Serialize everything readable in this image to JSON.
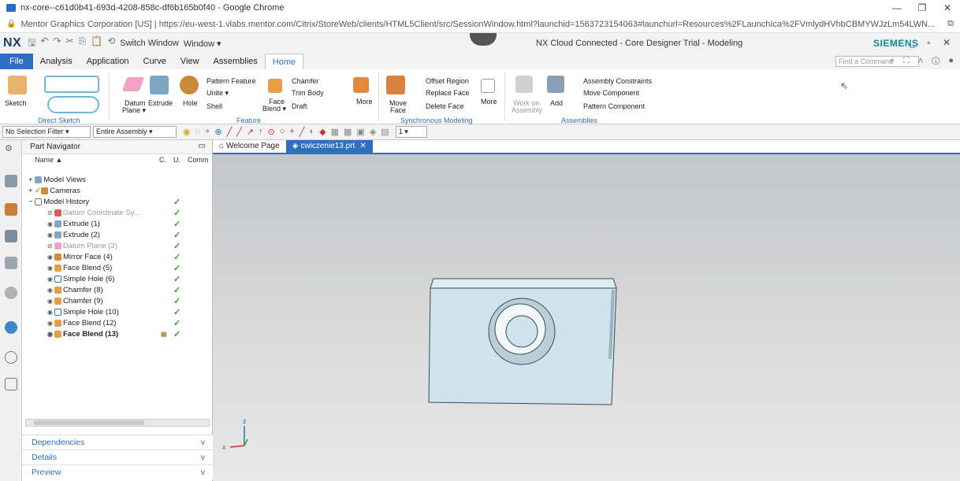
{
  "browser": {
    "title": "nx-core--c61d0b41-693d-4208-858c-df6b165b0f40 - Google Chrome",
    "url": "Mentor Graphics Corporation [US]  |  https://eu-west-1.vlabs.mentor.com/Citrix/StoreWeb/clients/HTML5Client/src/SessionWindow.html?launchid=1563723154063#launchurl=Resources%2FLaunchIca%2FVmlydHVhbCBMYWJzLm54LWN..."
  },
  "app": {
    "logo": "NX",
    "switch_window": "Switch Window",
    "window_menu": "Window ▾",
    "title": "NX Cloud Connected - Core Designer Trial - Modeling",
    "brand": "SIEMENS",
    "find_command": "Find a Command"
  },
  "tabs": [
    "File",
    "Analysis",
    "Application",
    "Curve",
    "View",
    "Assemblies",
    "Home"
  ],
  "ribbon": {
    "sketch": "Sketch",
    "direct_sketch": "Direct Sketch",
    "datum_plane": "Datum",
    "datum_plane2": "Plane ▾",
    "extrude": "Extrude",
    "hole": "Hole",
    "pattern_feature": "Pattern Feature",
    "unite": "Unite ▾",
    "shell": "Shell",
    "chamfer": "Chamfer",
    "trim_body": "Trim Body",
    "draft": "Draft",
    "face_blend": "Face",
    "face_blend2": "Blend ▾",
    "more": "More",
    "feature": "Feature",
    "move_face": "Move",
    "move_face2": "Face",
    "offset_region": "Offset Region",
    "replace_face": "Replace Face",
    "delete_face": "Delete Face",
    "more2": "More",
    "synchronous": "Synchronous Modeling",
    "work_on": "Work on",
    "work_on2": "Assembly",
    "add": "Add",
    "assembly_constraints": "Assembly Constraints",
    "move_component": "Move Component",
    "pattern_component": "Pattern Component",
    "assemblies": "Assemblies"
  },
  "selbar": {
    "filter": "No Selection Filter",
    "scope": "Entire Assembly",
    "number": "1"
  },
  "navigator": {
    "title": "Part Navigator",
    "col_name": "Name",
    "col_c": "C.",
    "col_u": "U.",
    "col_comm": "Comm",
    "rows": [
      {
        "label": "Model Views",
        "indent": 0
      },
      {
        "label": "Cameras",
        "indent": 0
      },
      {
        "label": "Model History",
        "indent": 0
      },
      {
        "label": "Datum Coordinate Sy...",
        "indent": 1
      },
      {
        "label": "Extrude (1)",
        "indent": 1
      },
      {
        "label": "Extrude (2)",
        "indent": 1
      },
      {
        "label": "Datum Plane (3)",
        "indent": 1
      },
      {
        "label": "Mirror Face (4)",
        "indent": 1
      },
      {
        "label": "Face Blend (5)",
        "indent": 1
      },
      {
        "label": "Simple Hole (6)",
        "indent": 1
      },
      {
        "label": "Chamfer (8)",
        "indent": 1
      },
      {
        "label": "Chamfer (9)",
        "indent": 1
      },
      {
        "label": "Simple Hole (10)",
        "indent": 1
      },
      {
        "label": "Face Blend (12)",
        "indent": 1
      },
      {
        "label": "Face Blend (13)",
        "indent": 1
      }
    ],
    "panels": [
      "Dependencies",
      "Details",
      "Preview"
    ]
  },
  "doc_tabs": [
    "Welcome Page",
    "cwiczenie13.prt"
  ],
  "triad": {
    "z": "z",
    "x": "x"
  }
}
